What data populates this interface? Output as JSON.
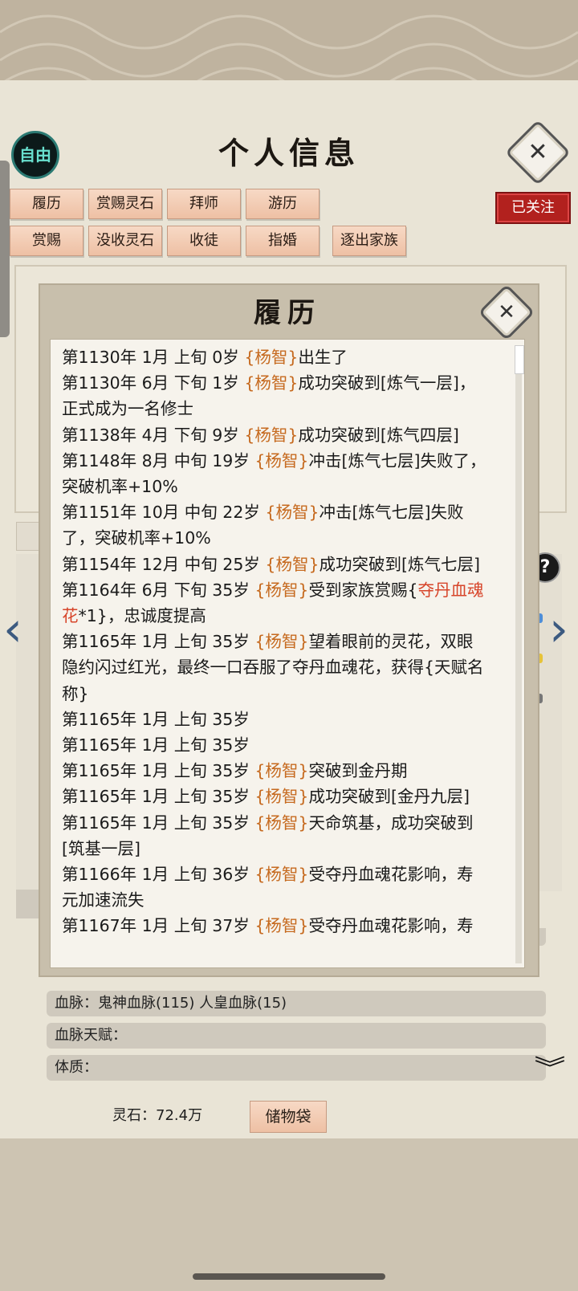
{
  "header": {
    "free_label": "自由",
    "title": "个人信息",
    "close_symbol": "✕",
    "followed_label": "已关注"
  },
  "tabs_row1": [
    "履历",
    "赏赐灵石",
    "拜师",
    "游历"
  ],
  "tabs_row2": [
    "赏赐",
    "没收灵石",
    "收徒",
    "指婚",
    "逐出家族"
  ],
  "modal": {
    "title": "履历",
    "close_symbol": "✕",
    "entries": [
      [
        {
          "t": "第1130年 1月 上旬  0岁  "
        },
        {
          "t": "{杨智}",
          "c": "nm"
        },
        {
          "t": "出生了"
        }
      ],
      [
        {
          "t": "第1130年 6月 下旬 1岁 "
        },
        {
          "t": "{杨智}",
          "c": "nm"
        },
        {
          "t": "成功突破到[炼气一层]，正式成为一名修士"
        }
      ],
      [
        {
          "t": "第1138年 4月  下旬  9岁  "
        },
        {
          "t": "{杨智}",
          "c": "nm"
        },
        {
          "t": "成功突破到[炼气四层]"
        }
      ],
      [
        {
          "t": "第1148年 8月  中旬   19岁   "
        },
        {
          "t": "{杨智}",
          "c": "nm"
        },
        {
          "t": "冲击[炼气七层]失败了，突破机率+10%"
        }
      ],
      [
        {
          "t": "第1151年 10月  中旬   22岁   "
        },
        {
          "t": "{杨智}",
          "c": "nm"
        },
        {
          "t": "冲击[炼气七层]失败了，突破机率+10%"
        }
      ],
      [
        {
          "t": "第1154年 12月 中旬 25岁 "
        },
        {
          "t": "{杨智}",
          "c": "nm"
        },
        {
          "t": "成功突破到[炼气七层]"
        }
      ],
      [
        {
          "t": "第1164年 6月  下旬   35岁  "
        },
        {
          "t": "{杨智}",
          "c": "nm"
        },
        {
          "t": "受到家族赏赐{"
        },
        {
          "t": "夺丹血魂花",
          "c": "it"
        },
        {
          "t": "*1}，忠诚度提高"
        }
      ],
      [
        {
          "t": "第1165年 1月 上旬 35岁 "
        },
        {
          "t": "{杨智}",
          "c": "nm"
        },
        {
          "t": "望着眼前的灵花，双眼隐约闪过红光，最终一口吞服了夺丹血魂花，获得{天赋名称}"
        }
      ],
      [
        {
          "t": "第1165年 1月  上旬   35岁"
        }
      ],
      [
        {
          "t": "第1165年 1月  上旬   35岁"
        }
      ],
      [
        {
          "t": "第1165年 1月  上旬   35岁   "
        },
        {
          "t": "{杨智}",
          "c": "nm"
        },
        {
          "t": "突破到金丹期"
        }
      ],
      [
        {
          "t": "第1165年 1月  上旬  35岁  "
        },
        {
          "t": "{杨智}",
          "c": "nm"
        },
        {
          "t": "成功突破到[金丹九层]"
        }
      ],
      [
        {
          "t": "第1165年 1月 上旬 35岁 "
        },
        {
          "t": "{杨智}",
          "c": "nm"
        },
        {
          "t": "天命筑基，成功突破到[筑基一层]"
        }
      ],
      [
        {
          "t": "第1166年 1月 上旬 36岁 "
        },
        {
          "t": "{杨智}",
          "c": "nm"
        },
        {
          "t": "受夺丹血魂花影响，寿元加速流失"
        }
      ],
      [
        {
          "t": "第1167年 1月 上旬 37岁 "
        },
        {
          "t": "{杨智}",
          "c": "nm"
        },
        {
          "t": "受夺丹血魂花影响，寿"
        }
      ]
    ]
  },
  "bottom": {
    "bloodline": "血脉：鬼神血脉(115)   人皇血脉(15)",
    "bloodline_talent": "血脉天赋：",
    "physique": "体质：",
    "spirit_stones": "灵石：72.4万",
    "storage_label": "储物袋"
  },
  "colors": {
    "name": "#c66a1f",
    "item": "#d7452a",
    "followed_bg": "#b2211e",
    "tab_bg": "#eec0a4"
  }
}
